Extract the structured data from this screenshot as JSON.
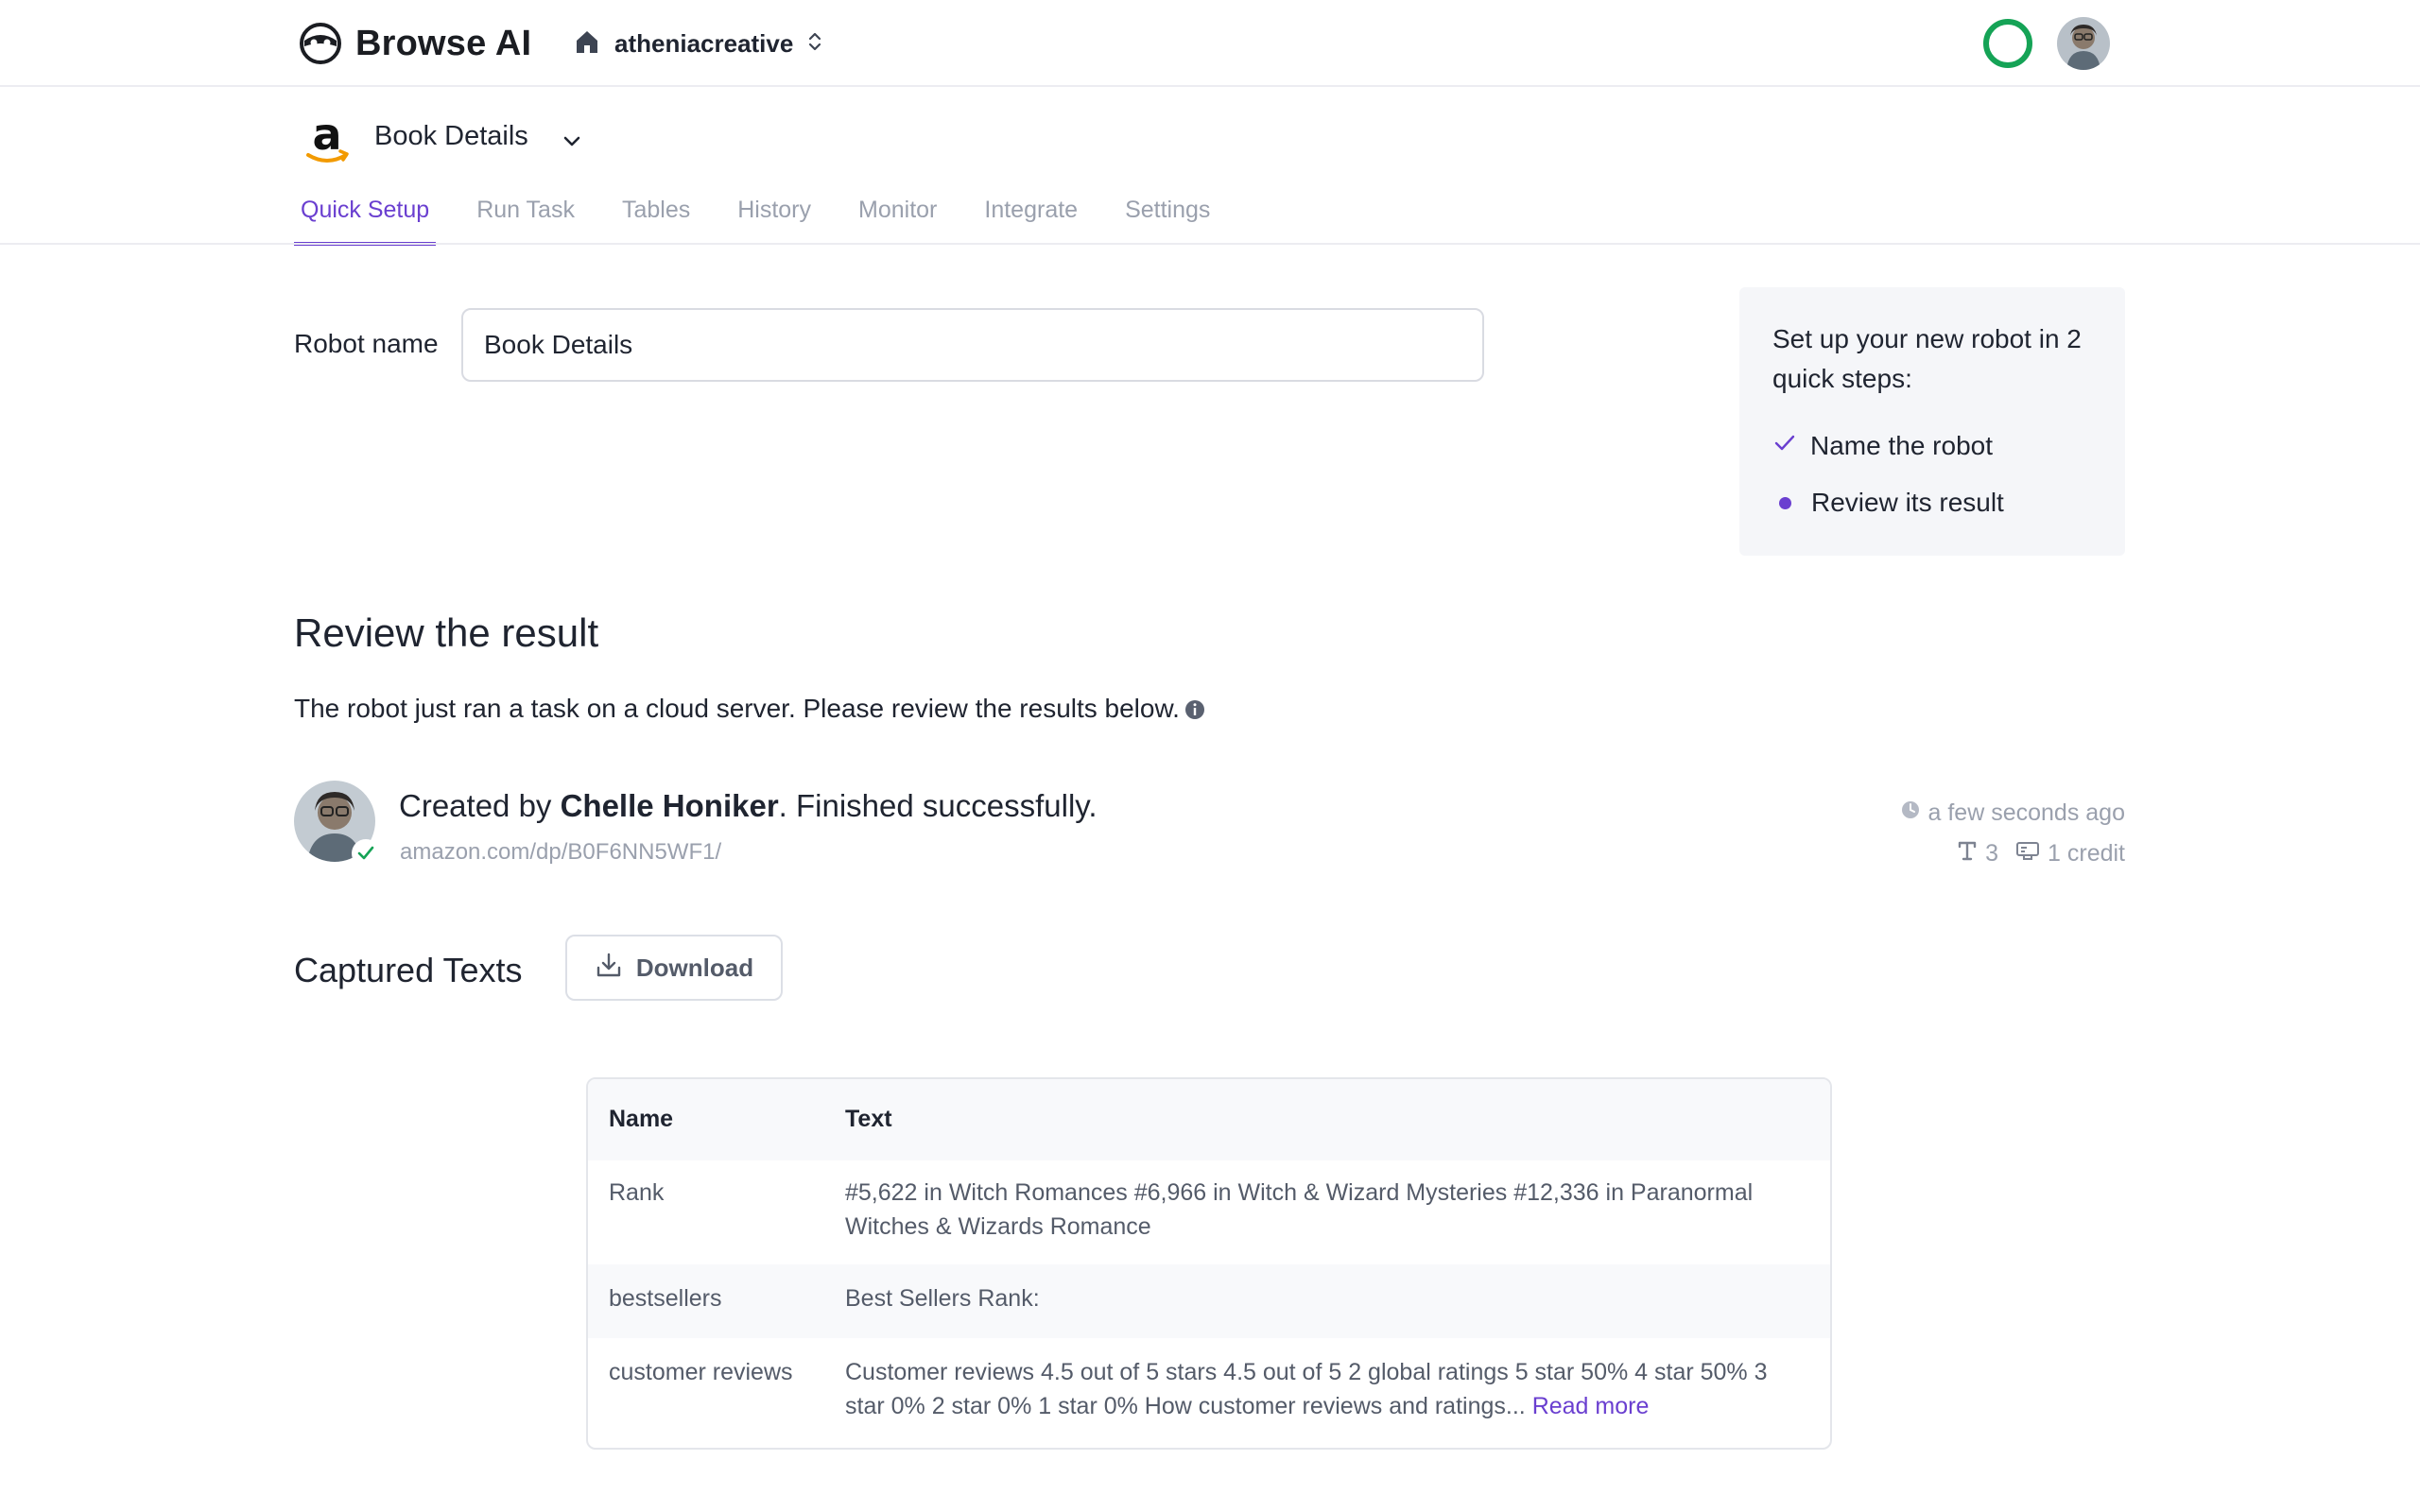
{
  "brand": {
    "name": "Browse AI"
  },
  "workspace": {
    "name": "atheniacreative"
  },
  "robot": {
    "title": "Book Details"
  },
  "tabs": [
    {
      "label": "Quick Setup"
    },
    {
      "label": "Run Task"
    },
    {
      "label": "Tables"
    },
    {
      "label": "History"
    },
    {
      "label": "Monitor"
    },
    {
      "label": "Integrate"
    },
    {
      "label": "Settings"
    }
  ],
  "form": {
    "label": "Robot name",
    "value": "Book Details"
  },
  "steps": {
    "title": "Set up your new robot in 2 quick steps:",
    "items": [
      {
        "label": "Name the robot",
        "state": "done"
      },
      {
        "label": "Review its result",
        "state": "current"
      }
    ]
  },
  "review": {
    "title": "Review the result",
    "description": "The robot just ran a task on a cloud server. Please review the results below."
  },
  "run": {
    "created_prefix": "Created by ",
    "author": "Chelle Honiker",
    "status_suffix": ". Finished successfully.",
    "url": "amazon.com/dp/B0F6NN5WF1/",
    "time": "a few seconds ago",
    "texts_count": "3",
    "credits": "1 credit"
  },
  "captured": {
    "title": "Captured Texts",
    "download_label": "Download",
    "columns": [
      "Name",
      "Text"
    ],
    "rows": [
      {
        "name": "Rank",
        "text": "#5,622 in Witch Romances #6,966 in Witch & Wizard Mysteries #12,336 in Paranormal Witches & Wizards Romance"
      },
      {
        "name": "bestsellers",
        "text": "Best Sellers Rank:"
      },
      {
        "name": "customer reviews",
        "text": "Customer reviews 4.5 out of 5 stars 4.5 out of 5 2 global ratings 5 star 50% 4 star 50% 3 star 0% 2 star 0% 1 star 0% How customer reviews and ratings...",
        "link": "Read more"
      }
    ]
  },
  "colors": {
    "accent": "#6a3fd0",
    "success": "#15a356",
    "muted": "#9aa0ad"
  }
}
